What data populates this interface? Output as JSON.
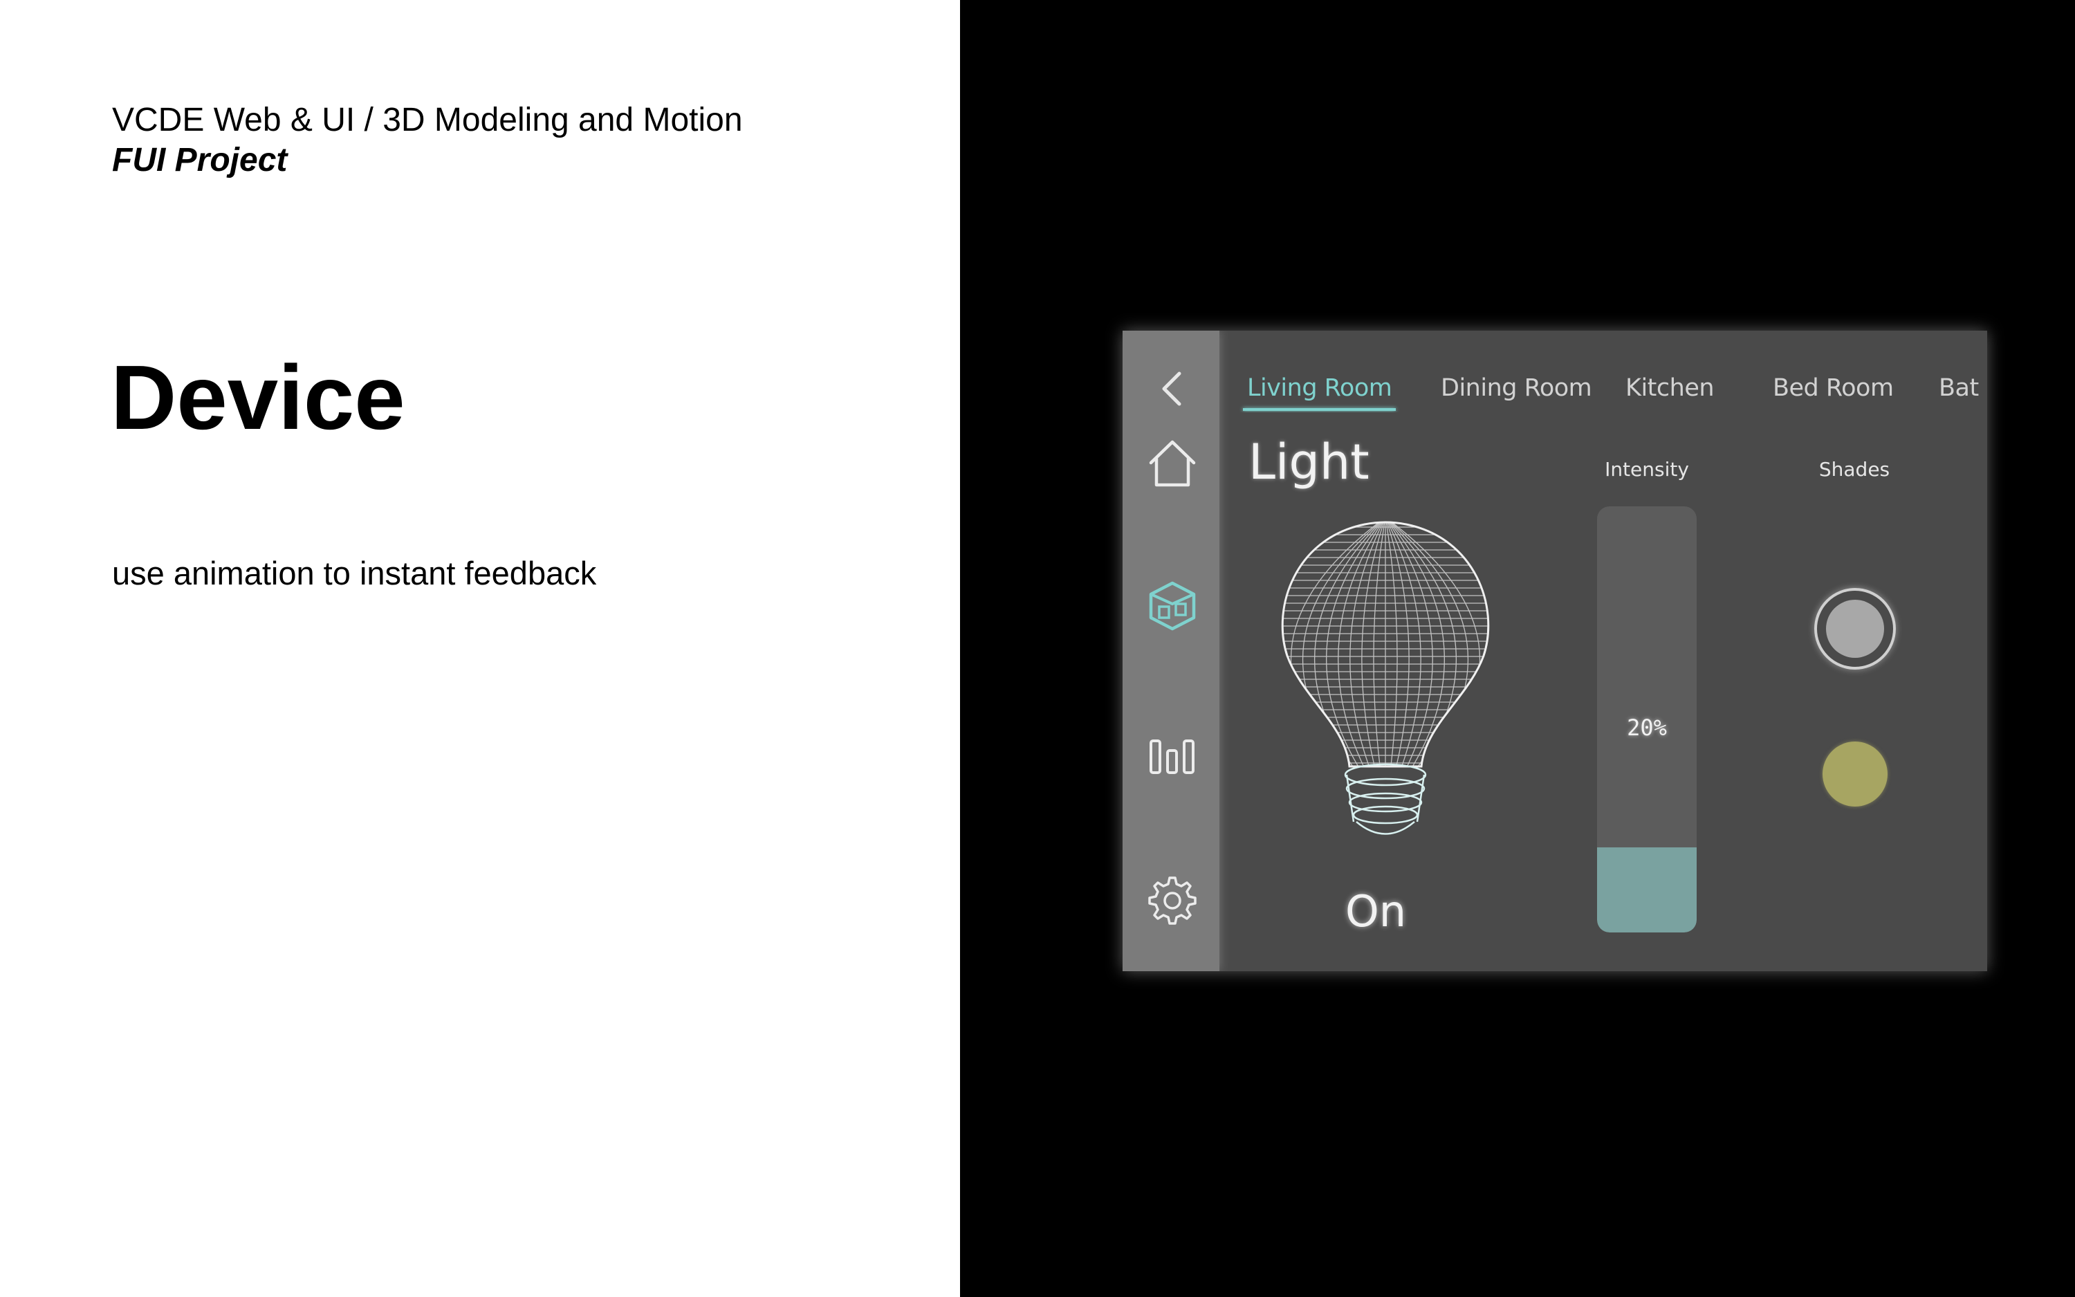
{
  "slide": {
    "course_line": "VCDE Web & UI / 3D Modeling and Motion",
    "project_line": "FUI Project",
    "heading": "Device",
    "description": "use animation to instant feedback"
  },
  "device": {
    "sidebar": {
      "items": [
        {
          "name": "back",
          "icon": "chevron-left-icon"
        },
        {
          "name": "home",
          "icon": "home-icon"
        },
        {
          "name": "devices",
          "icon": "cube-icon",
          "active": true
        },
        {
          "name": "stats",
          "icon": "bar-chart-icon"
        },
        {
          "name": "settings",
          "icon": "gear-icon"
        }
      ]
    },
    "tabs": [
      {
        "label": "Living Room",
        "active": true
      },
      {
        "label": "Dining Room"
      },
      {
        "label": "Kitchen"
      },
      {
        "label": "Bed Room"
      },
      {
        "label": "Bat"
      }
    ],
    "section_title": "Light",
    "intensity": {
      "label": "Intensity",
      "value_text": "20%",
      "value": 0.2
    },
    "shades": {
      "label": "Shades",
      "color": "#a7a562"
    },
    "light_state": "On",
    "colors": {
      "accent": "#7fd2ce",
      "panel": "#4a4a4a",
      "rail": "#7b7b7b",
      "fill": "#7aa2a0"
    }
  }
}
